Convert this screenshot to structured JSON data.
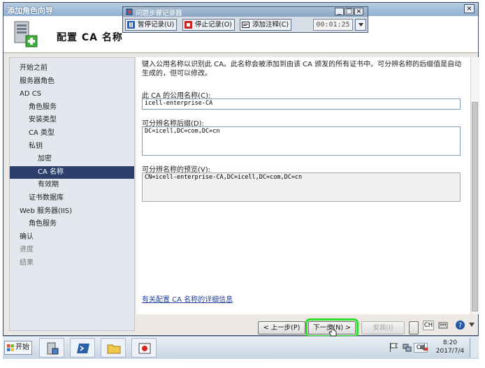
{
  "window": {
    "title": "添加角色向导",
    "close_label": "×",
    "header_title": "配置 CA 名称"
  },
  "recorder": {
    "title": "问题步骤记录器",
    "pause_label": "暂停记录(U)",
    "stop_label": "停止记录(O)",
    "comment_label": "添加注释(C)",
    "timer": "00:01:25",
    "min_label": "_",
    "max_label": "□",
    "close_label": "×"
  },
  "sidebar": {
    "items": [
      {
        "label": "开始之前",
        "indent": 0
      },
      {
        "label": "服务器角色",
        "indent": 0
      },
      {
        "label": "AD CS",
        "indent": 0
      },
      {
        "label": "角色服务",
        "indent": 1
      },
      {
        "label": "安装类型",
        "indent": 1
      },
      {
        "label": "CA 类型",
        "indent": 1
      },
      {
        "label": "私钥",
        "indent": 1
      },
      {
        "label": "加密",
        "indent": 2
      },
      {
        "label": "CA 名称",
        "indent": 2,
        "selected": true
      },
      {
        "label": "有效期",
        "indent": 2
      },
      {
        "label": "证书数据库",
        "indent": 1
      },
      {
        "label": "Web 服务器(IIS)",
        "indent": 0
      },
      {
        "label": "角色服务",
        "indent": 1
      },
      {
        "label": "确认",
        "indent": 0
      },
      {
        "label": "进度",
        "indent": 0,
        "dim": true
      },
      {
        "label": "结果",
        "indent": 0,
        "dim": true
      }
    ]
  },
  "content": {
    "description": "键入公用名称以识别此 CA。此名称会被添加到由该 CA 颁发的所有证书中。可分辨名称的后缀值是自动生成的，但可以修改。",
    "common_name_label": "此 CA 的公用名称(C):",
    "common_name_value": "icell-enterprise-CA",
    "dn_suffix_label": "可分辨名称后缀(D):",
    "dn_suffix_value": "DC=icell,DC=com,DC=cn",
    "preview_label": "可分辨名称的预览(V):",
    "preview_value": "CN=icell-enterprise-CA,DC=icell,DC=com,DC=cn",
    "help_link": "有关配置 CA 名称的详细信息"
  },
  "buttons": {
    "back": "< 上一步(P)",
    "next": "下一步(N) >",
    "install": "安装(I)",
    "cancel": "取消"
  },
  "taskbar": {
    "start_label": "开始",
    "lang": "CH",
    "time": "8:20",
    "date": "2017/7/4"
  },
  "colors": {
    "selected_nav": "#2c3e6a",
    "highlight_outline": "#2dde2b",
    "link": "#1f3f9c"
  }
}
